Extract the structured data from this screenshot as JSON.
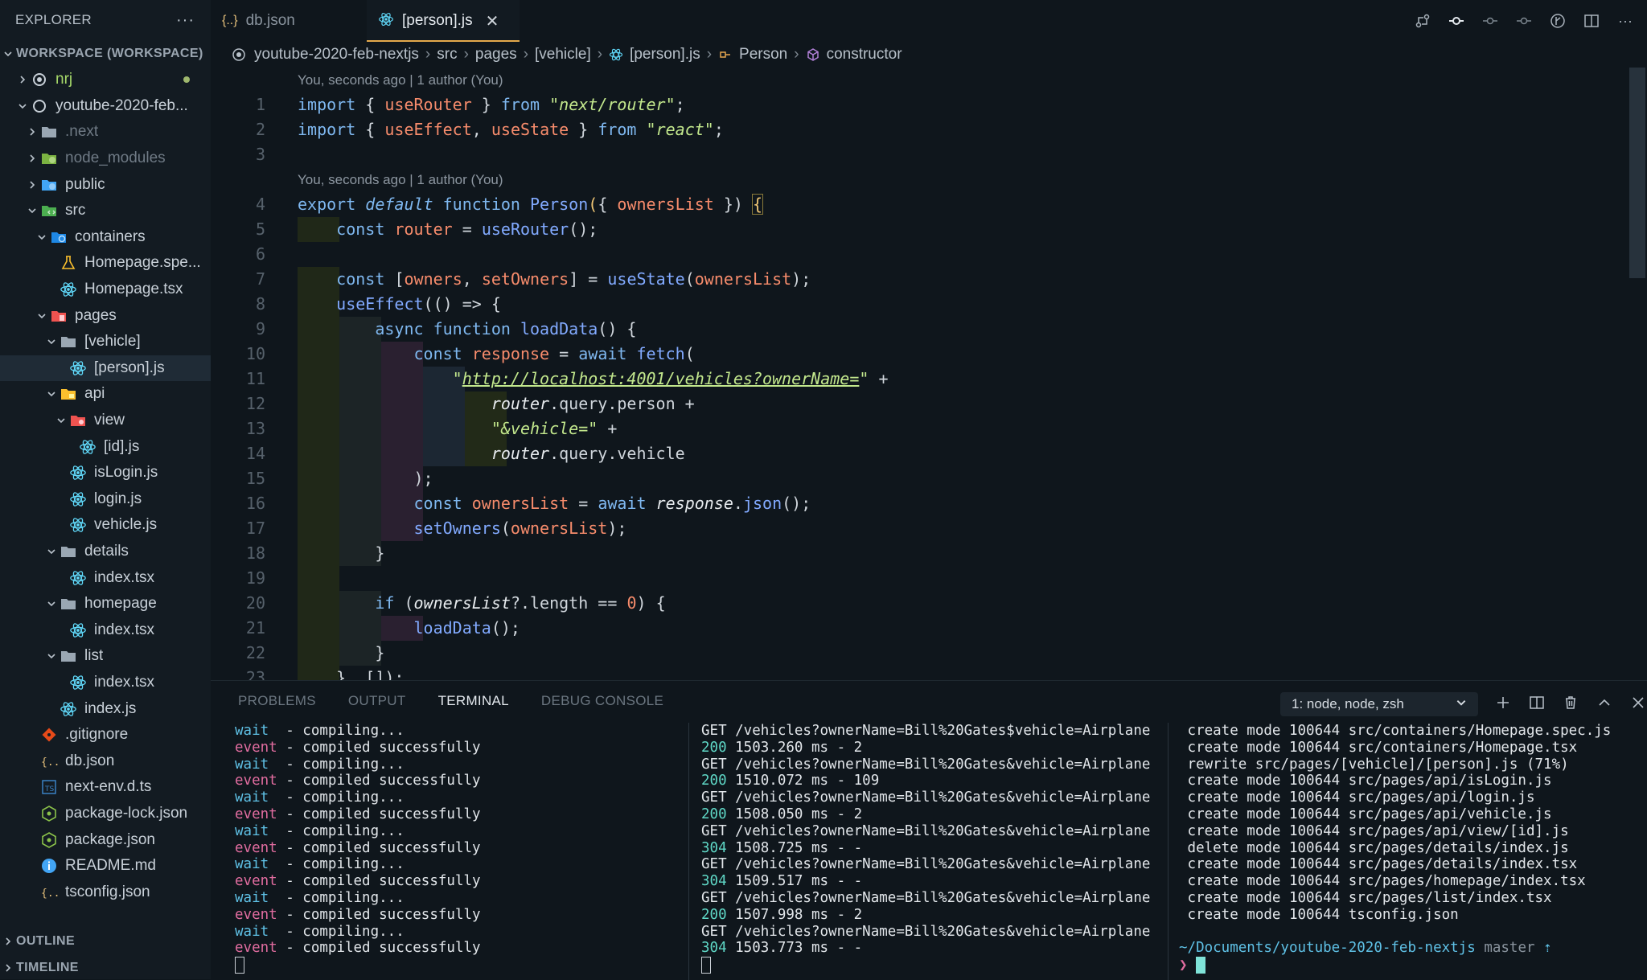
{
  "sidebar": {
    "title": "EXPLORER",
    "workspace_label": "WORKSPACE (WORKSPACE)",
    "tree": [
      {
        "label": "nrj",
        "depth": 0,
        "type": "root-closed",
        "icon": "circle-dot-icon",
        "dim": false
      },
      {
        "label": "youtube-2020-feb...",
        "depth": 0,
        "type": "root-open",
        "icon": "circle-icon"
      },
      {
        "label": ".next",
        "depth": 1,
        "type": "folder-closed",
        "icon": "folder-icon",
        "dim": true
      },
      {
        "label": "node_modules",
        "depth": 1,
        "type": "folder-closed",
        "icon": "node-folder-icon",
        "dim": true
      },
      {
        "label": "public",
        "depth": 1,
        "type": "folder-closed",
        "icon": "public-folder-icon"
      },
      {
        "label": "src",
        "depth": 1,
        "type": "folder-open",
        "icon": "src-folder-icon"
      },
      {
        "label": "containers",
        "depth": 2,
        "type": "folder-open",
        "icon": "containers-folder-icon"
      },
      {
        "label": "Homepage.spe...",
        "depth": 3,
        "type": "file",
        "icon": "test-flask-icon"
      },
      {
        "label": "Homepage.tsx",
        "depth": 3,
        "type": "file",
        "icon": "react-icon"
      },
      {
        "label": "pages",
        "depth": 2,
        "type": "folder-open",
        "icon": "pages-folder-icon"
      },
      {
        "label": "[vehicle]",
        "depth": 3,
        "type": "folder-open",
        "icon": "folder-icon"
      },
      {
        "label": "[person].js",
        "depth": 4,
        "type": "file",
        "icon": "react-icon",
        "selected": true
      },
      {
        "label": "api",
        "depth": 3,
        "type": "folder-open",
        "icon": "api-folder-icon"
      },
      {
        "label": "view",
        "depth": 4,
        "type": "folder-open",
        "icon": "view-folder-icon"
      },
      {
        "label": "[id].js",
        "depth": 5,
        "type": "file",
        "icon": "react-icon"
      },
      {
        "label": "isLogin.js",
        "depth": 4,
        "type": "file",
        "icon": "react-icon"
      },
      {
        "label": "login.js",
        "depth": 4,
        "type": "file",
        "icon": "react-icon"
      },
      {
        "label": "vehicle.js",
        "depth": 4,
        "type": "file",
        "icon": "react-icon"
      },
      {
        "label": "details",
        "depth": 3,
        "type": "folder-open",
        "icon": "folder-icon"
      },
      {
        "label": "index.tsx",
        "depth": 4,
        "type": "file",
        "icon": "react-icon"
      },
      {
        "label": "homepage",
        "depth": 3,
        "type": "folder-open",
        "icon": "folder-icon"
      },
      {
        "label": "index.tsx",
        "depth": 4,
        "type": "file",
        "icon": "react-icon"
      },
      {
        "label": "list",
        "depth": 3,
        "type": "folder-open",
        "icon": "folder-icon"
      },
      {
        "label": "index.tsx",
        "depth": 4,
        "type": "file",
        "icon": "react-icon"
      },
      {
        "label": "index.js",
        "depth": 3,
        "type": "file",
        "icon": "react-icon"
      },
      {
        "label": ".gitignore",
        "depth": 1,
        "type": "file",
        "icon": "git-icon"
      },
      {
        "label": "db.json",
        "depth": 1,
        "type": "file",
        "icon": "json-icon"
      },
      {
        "label": "next-env.d.ts",
        "depth": 1,
        "type": "file",
        "icon": "ts-icon"
      },
      {
        "label": "package-lock.json",
        "depth": 1,
        "type": "file",
        "icon": "npm-icon"
      },
      {
        "label": "package.json",
        "depth": 1,
        "type": "file",
        "icon": "npm-icon"
      },
      {
        "label": "README.md",
        "depth": 1,
        "type": "file",
        "icon": "info-icon"
      },
      {
        "label": "tsconfig.json",
        "depth": 1,
        "type": "file",
        "icon": "json-icon"
      }
    ],
    "outline_label": "OUTLINE",
    "timeline_label": "TIMELINE"
  },
  "tabs": [
    {
      "label": "db.json",
      "icon": "json-icon",
      "active": false
    },
    {
      "label": "[person].js",
      "icon": "react-icon",
      "active": true
    }
  ],
  "breadcrumb": [
    "youtube-2020-feb-nextjs",
    "src",
    "pages",
    "[vehicle]",
    "[person].js",
    "Person",
    "constructor"
  ],
  "editor": {
    "lens1": "You, seconds ago | 1 author (You)",
    "lens2": "You, seconds ago | 1 author (You)"
  },
  "panel": {
    "tabs": [
      "PROBLEMS",
      "OUTPUT",
      "TERMINAL",
      "DEBUG CONSOLE"
    ],
    "active_tab": "TERMINAL",
    "terminal_select": "1: node, node, zsh",
    "term1": [
      [
        "wait",
        "  - compiling..."
      ],
      [
        "event",
        " - compiled successfully"
      ],
      [
        "wait",
        "  - compiling..."
      ],
      [
        "event",
        " - compiled successfully"
      ],
      [
        "wait",
        "  - compiling..."
      ],
      [
        "event",
        " - compiled successfully"
      ],
      [
        "wait",
        "  - compiling..."
      ],
      [
        "event",
        " - compiled successfully"
      ],
      [
        "wait",
        "  - compiling..."
      ],
      [
        "event",
        " - compiled successfully"
      ],
      [
        "wait",
        "  - compiling..."
      ],
      [
        "event",
        " - compiled successfully"
      ],
      [
        "wait",
        "  - compiling..."
      ],
      [
        "event",
        " - compiled successfully"
      ]
    ],
    "term2": [
      [
        "",
        "GET /vehicles?ownerName=Bill%20Gates$vehicle=Airplane"
      ],
      [
        "200",
        " 1503.260 ms - 2"
      ],
      [
        "",
        "GET /vehicles?ownerName=Bill%20Gates&vehicle=Airplane"
      ],
      [
        "200",
        " 1510.072 ms - 109"
      ],
      [
        "",
        "GET /vehicles?ownerName=Bill%20Gates&vehicle=Airplane"
      ],
      [
        "200",
        " 1508.050 ms - 2"
      ],
      [
        "",
        "GET /vehicles?ownerName=Bill%20Gates&vehicle=Airplane"
      ],
      [
        "304",
        " 1508.725 ms - -"
      ],
      [
        "",
        "GET /vehicles?ownerName=Bill%20Gates&vehicle=Airplane"
      ],
      [
        "304",
        " 1509.517 ms - -"
      ],
      [
        "",
        "GET /vehicles?ownerName=Bill%20Gates&vehicle=Airplane"
      ],
      [
        "200",
        " 1507.998 ms - 2"
      ],
      [
        "",
        "GET /vehicles?ownerName=Bill%20Gates&vehicle=Airplane"
      ],
      [
        "304",
        " 1503.773 ms - -"
      ]
    ],
    "term3": [
      " create mode 100644 src/containers/Homepage.spec.js",
      " create mode 100644 src/containers/Homepage.tsx",
      " rewrite src/pages/[vehicle]/[person].js (71%)",
      " create mode 100644 src/pages/api/isLogin.js",
      " create mode 100644 src/pages/api/login.js",
      " create mode 100644 src/pages/api/vehicle.js",
      " create mode 100644 src/pages/api/view/[id].js",
      " delete mode 100644 src/pages/details/index.js",
      " create mode 100644 src/pages/details/index.tsx",
      " create mode 100644 src/pages/homepage/index.tsx",
      " create mode 100644 src/pages/list/index.tsx",
      " create mode 100644 tsconfig.json"
    ],
    "prompt_path": "~/Documents/youtube-2020-feb-nextjs",
    "prompt_branch": "master",
    "prompt_arrow": "⇡",
    "prompt_symbol": "❯"
  },
  "colors": {
    "accent": "#e4a94b",
    "background": "#0f161c",
    "sidebar": "#131b22",
    "selection": "#1f2b36"
  }
}
